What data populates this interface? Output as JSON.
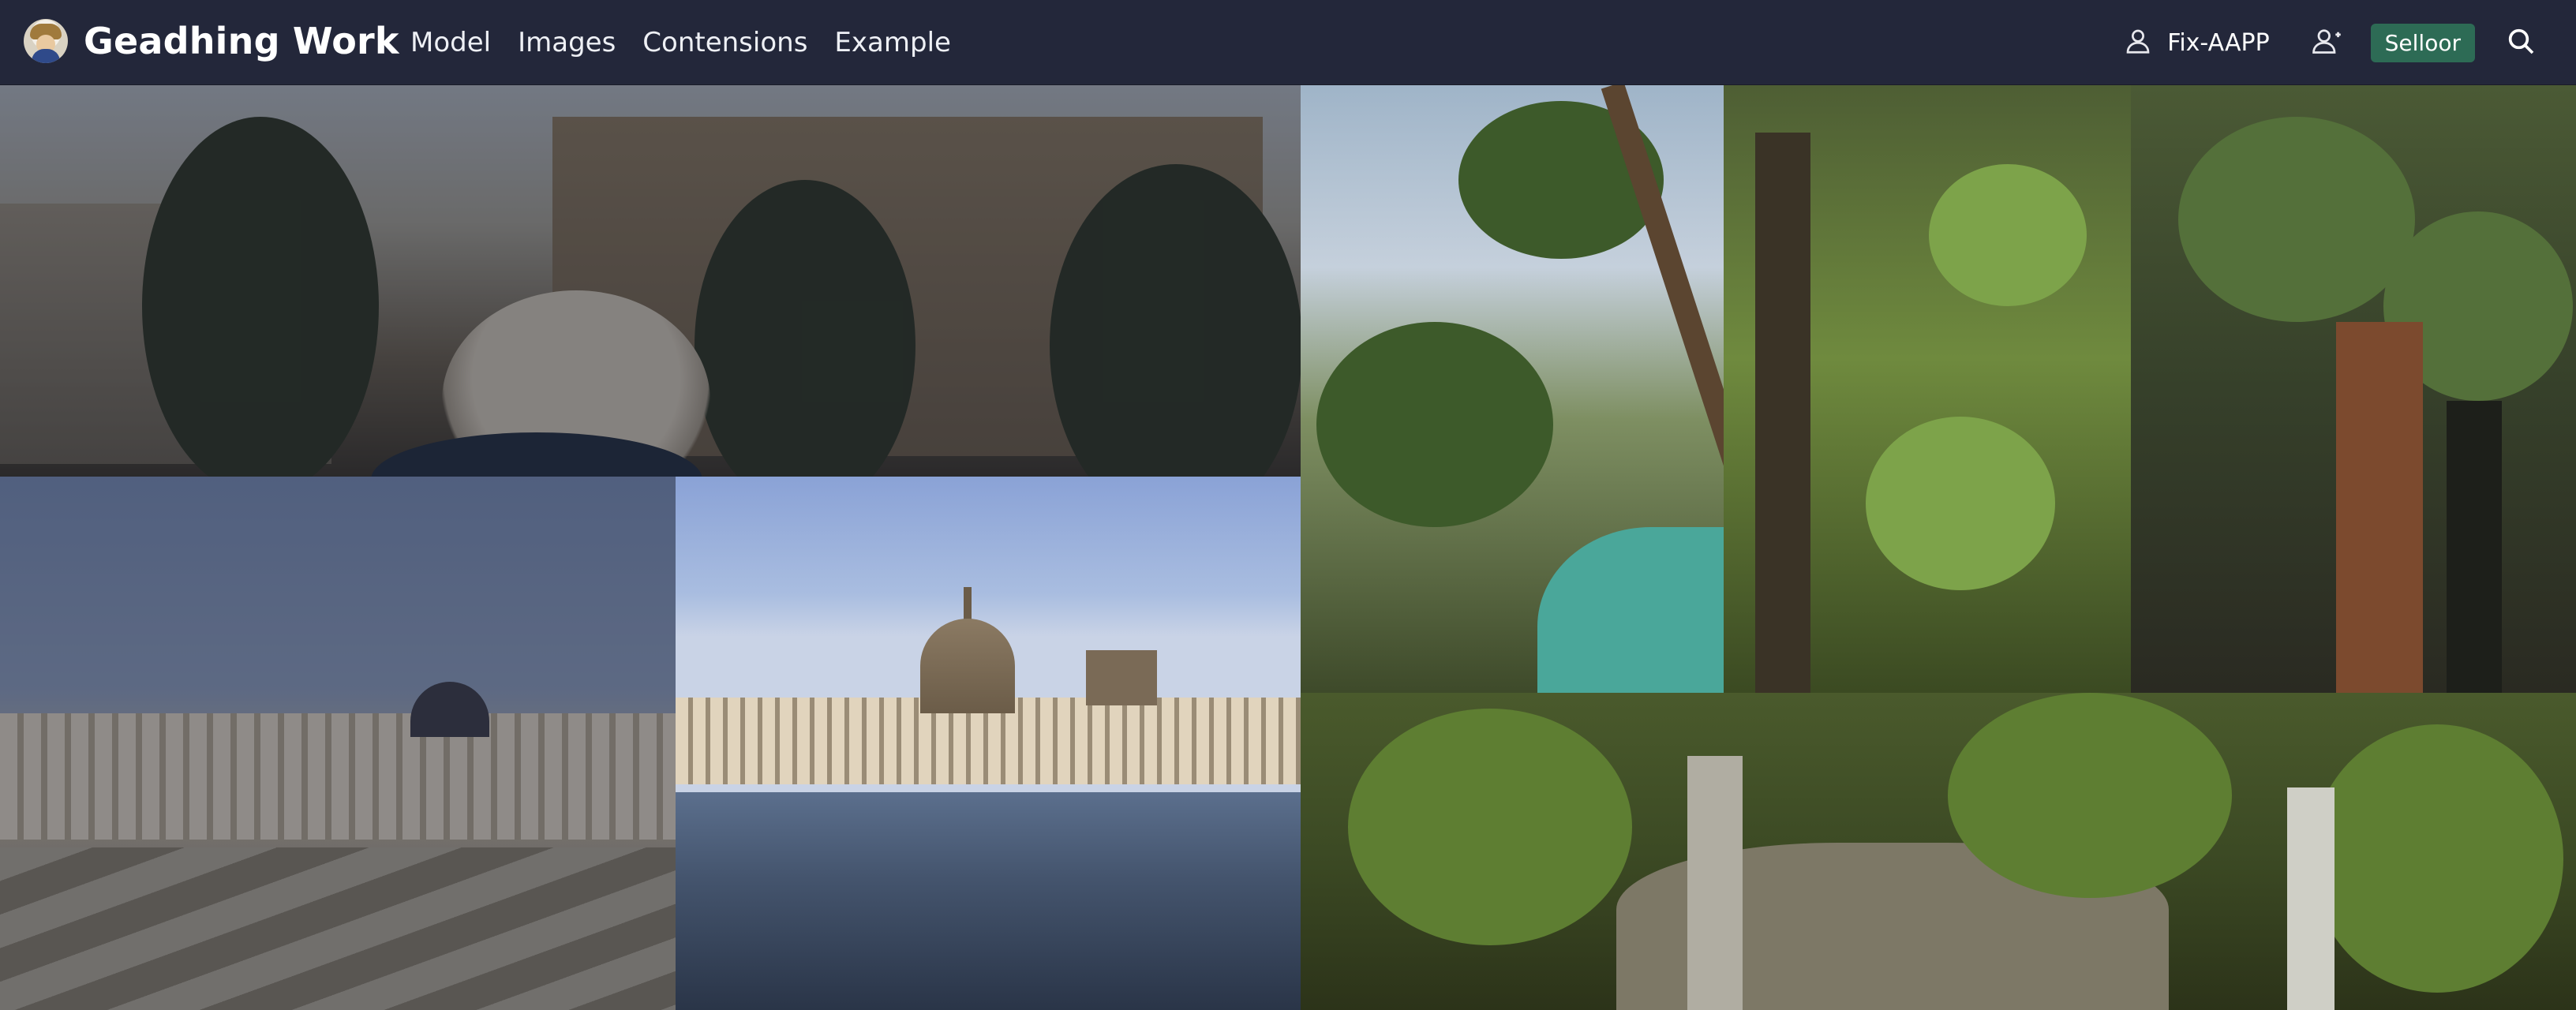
{
  "header": {
    "brand_name": "Geadhing Work",
    "nav": [
      {
        "label": "Model"
      },
      {
        "label": "Images"
      },
      {
        "label": "Contensions"
      },
      {
        "label": "Example"
      }
    ],
    "account_link_label": "Fix-AAPP",
    "sell_button_label": "Selloor",
    "icons": {
      "logo": "avatar-logo",
      "account": "user-icon",
      "add_user": "user-plus-icon",
      "search": "search-icon"
    },
    "colors": {
      "bar_background": "#23273a",
      "sell_button": "#2d6b55"
    }
  },
  "gallery": {
    "tiles": [
      {
        "subject": "old-building-with-person"
      },
      {
        "subject": "palace-square"
      },
      {
        "subject": "parliament-on-river"
      },
      {
        "subject": "tree-and-sky"
      },
      {
        "subject": "green-leaves"
      },
      {
        "subject": "dark-tree-trunk"
      },
      {
        "subject": "foliage-with-trunks"
      }
    ]
  }
}
